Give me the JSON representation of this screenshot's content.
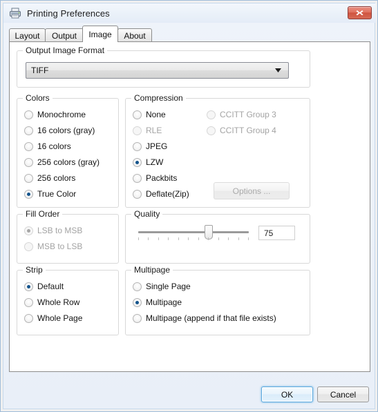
{
  "window": {
    "title": "Printing Preferences",
    "icon": "printer-icon",
    "close_label": "x"
  },
  "tabs": [
    {
      "label": "Layout",
      "active": false
    },
    {
      "label": "Output",
      "active": false
    },
    {
      "label": "Image",
      "active": true
    },
    {
      "label": "About",
      "active": false
    }
  ],
  "output_image_format": {
    "caption": "Output Image Format",
    "selected": "TIFF",
    "arrow_icon": "chevron-down-icon"
  },
  "colors": {
    "caption": "Colors",
    "options": [
      {
        "label": "Monochrome",
        "checked": false,
        "disabled": false
      },
      {
        "label": "16 colors (gray)",
        "checked": false,
        "disabled": false
      },
      {
        "label": "16 colors",
        "checked": false,
        "disabled": false
      },
      {
        "label": "256 colors (gray)",
        "checked": false,
        "disabled": false
      },
      {
        "label": "256 colors",
        "checked": false,
        "disabled": false
      },
      {
        "label": "True Color",
        "checked": true,
        "disabled": false
      }
    ]
  },
  "compression": {
    "caption": "Compression",
    "options_left": [
      {
        "label": "None",
        "checked": false,
        "disabled": false
      },
      {
        "label": "RLE",
        "checked": false,
        "disabled": true
      },
      {
        "label": "JPEG",
        "checked": false,
        "disabled": false
      },
      {
        "label": "LZW",
        "checked": true,
        "disabled": false
      },
      {
        "label": "Packbits",
        "checked": false,
        "disabled": false
      },
      {
        "label": "Deflate(Zip)",
        "checked": false,
        "disabled": false
      }
    ],
    "options_right": [
      {
        "label": "CCITT Group 3",
        "checked": false,
        "disabled": true
      },
      {
        "label": "CCITT Group 4",
        "checked": false,
        "disabled": true
      }
    ],
    "options_button": {
      "label": "Options ...",
      "disabled": true
    }
  },
  "fill_order": {
    "caption": "Fill Order",
    "disabled": true,
    "options": [
      {
        "label": "LSB to MSB",
        "checked": true,
        "disabled": true
      },
      {
        "label": "MSB to LSB",
        "checked": false,
        "disabled": true
      }
    ]
  },
  "quality": {
    "caption": "Quality",
    "value": "75",
    "min": 0,
    "max": 100,
    "tick_count": 12
  },
  "strip": {
    "caption": "Strip",
    "options": [
      {
        "label": "Default",
        "checked": true,
        "disabled": false
      },
      {
        "label": "Whole Row",
        "checked": false,
        "disabled": false
      },
      {
        "label": "Whole Page",
        "checked": false,
        "disabled": false
      }
    ]
  },
  "multipage": {
    "caption": "Multipage",
    "options": [
      {
        "label": "Single Page",
        "checked": false,
        "disabled": false
      },
      {
        "label": "Multipage",
        "checked": true,
        "disabled": false
      },
      {
        "label": "Multipage (append if that file exists)",
        "checked": false,
        "disabled": false
      }
    ]
  },
  "footer": {
    "ok_label": "OK",
    "cancel_label": "Cancel"
  },
  "colors_hex": {
    "accent_radio": "#14548c",
    "disabled_text": "#a3a3a3",
    "dialog_bg": "#f0f0f0",
    "page_bg": "#ffffff",
    "close_button": "#d66a55",
    "default_button_border": "#5aa8dd"
  }
}
